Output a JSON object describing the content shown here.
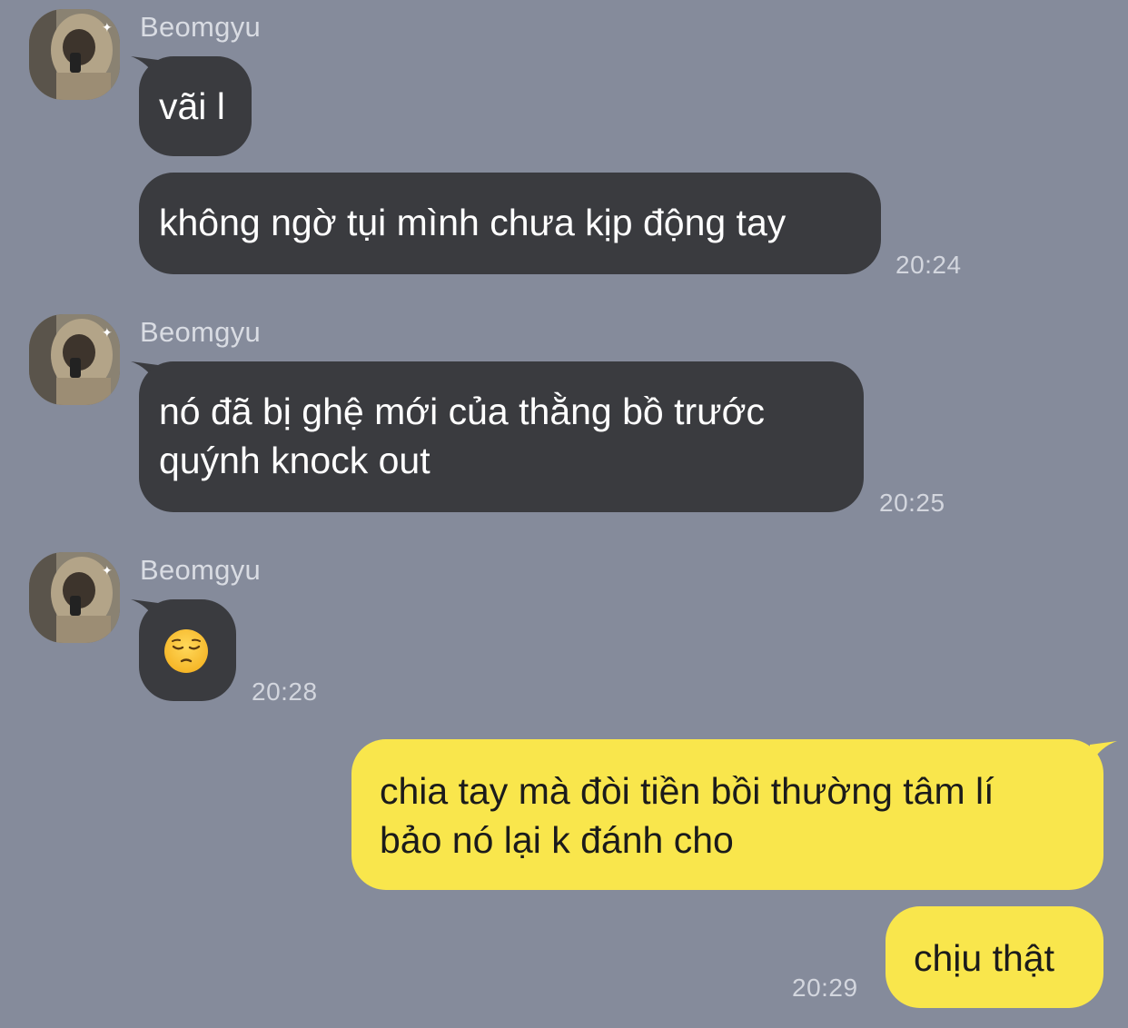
{
  "messages": [
    {
      "sender": "Beomgyu",
      "bubbles": [
        "vãi l",
        "không ngờ tụi mình chưa kịp động tay"
      ],
      "time": "20:24"
    },
    {
      "sender": "Beomgyu",
      "bubbles": [
        [
          "nó đã bị ghệ mới của thằng bồ trước",
          "quýnh knock out"
        ]
      ],
      "time": "20:25"
    },
    {
      "sender": "Beomgyu",
      "emoji": "pensive-face",
      "time": "20:28"
    }
  ],
  "mine": {
    "bubbles": [
      [
        "chia tay mà đòi tiền bồi thường tâm lí",
        "bảo nó lại k đánh cho"
      ],
      "chịu thật"
    ],
    "time": "20:29"
  },
  "colors": {
    "background": "#858b9b",
    "incoming_bubble": "#3a3b3f",
    "outgoing_bubble": "#f9e64c"
  }
}
